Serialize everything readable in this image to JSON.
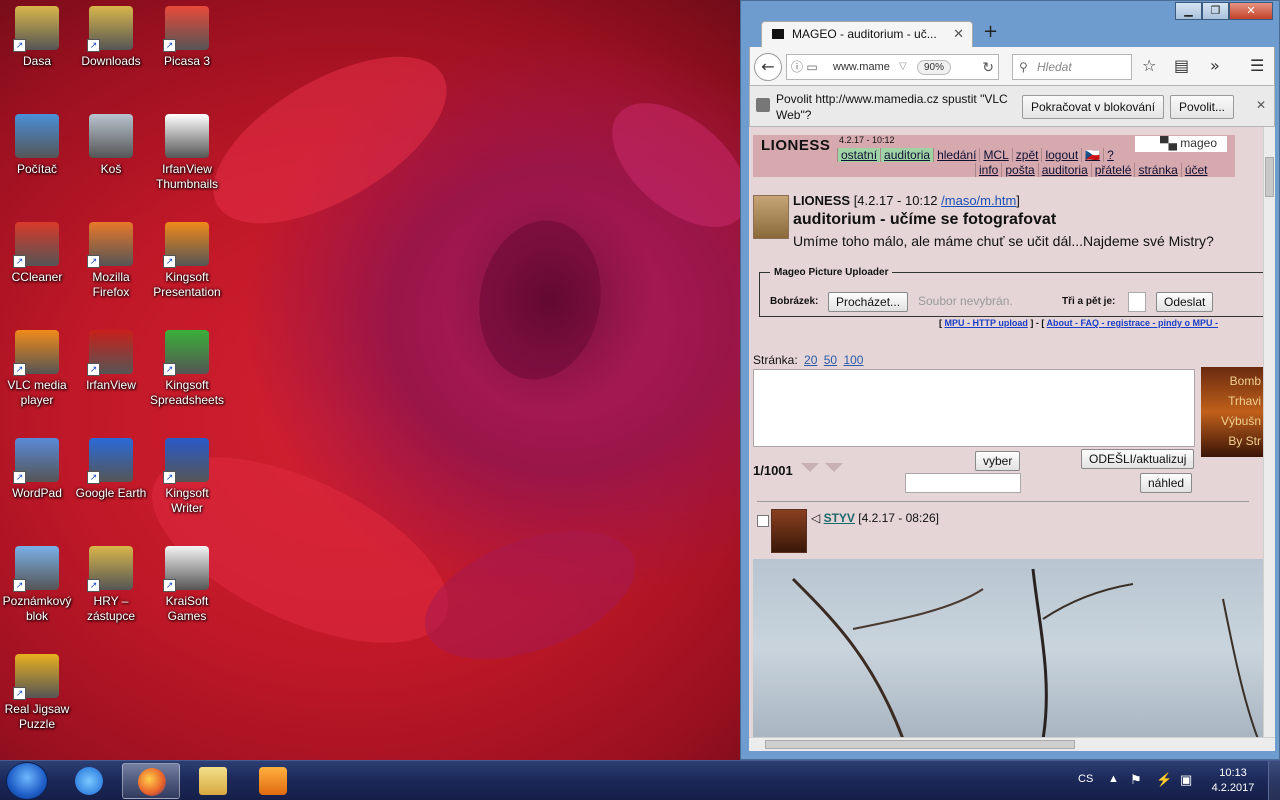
{
  "desktop": {
    "icons": [
      {
        "label": "Dasa",
        "icon": "user-folder-icon",
        "color": "#d8b64a"
      },
      {
        "label": "Downloads",
        "icon": "downloads-folder-icon",
        "color": "#d8b64a"
      },
      {
        "label": "Picasa 3",
        "icon": "picasa-icon",
        "color": "#e84a3a"
      },
      {
        "label": "Počítač",
        "icon": "computer-icon",
        "color": "#4a90d9"
      },
      {
        "label": "Koš",
        "icon": "recycle-bin-icon",
        "color": "#b8c4d0"
      },
      {
        "label": "IrfanView Thumbnails",
        "icon": "panda-icon",
        "color": "#ffffff"
      },
      {
        "label": "CCleaner",
        "icon": "ccleaner-icon",
        "color": "#d83a2a"
      },
      {
        "label": "Mozilla Firefox",
        "icon": "firefox-icon",
        "color": "#e8782a"
      },
      {
        "label": "Kingsoft Presentation",
        "icon": "kingsoft-presentation-icon",
        "color": "#f08a1a"
      },
      {
        "label": "VLC media player",
        "icon": "vlc-icon",
        "color": "#f08a1a"
      },
      {
        "label": "IrfanView",
        "icon": "irfanview-icon",
        "color": "#c8201a"
      },
      {
        "label": "Kingsoft Spreadsheets",
        "icon": "kingsoft-spreadsheets-icon",
        "color": "#3ab03a"
      },
      {
        "label": "WordPad",
        "icon": "wordpad-icon",
        "color": "#5a8ad8"
      },
      {
        "label": "Google Earth",
        "icon": "google-earth-icon",
        "color": "#2a6ad8"
      },
      {
        "label": "Kingsoft Writer",
        "icon": "kingsoft-writer-icon",
        "color": "#2a5ac8"
      },
      {
        "label": "Poznámkový blok",
        "icon": "notepad-icon",
        "color": "#7ab0e8"
      },
      {
        "label": "HRY – zástupce",
        "icon": "games-folder-icon",
        "color": "#d8b64a"
      },
      {
        "label": "KraiSoft Games",
        "icon": "file-icon",
        "color": "#f4f4f4"
      },
      {
        "label": "Real Jigsaw Puzzle",
        "icon": "jigsaw-icon",
        "color": "#e8b020"
      }
    ]
  },
  "browser": {
    "tab_title": "MAGEO - auditorium - uč...",
    "new_tab": "+",
    "url": "www.mame",
    "zoom": "90%",
    "search_placeholder": "Hledat",
    "notification": {
      "message": "Povolit http://www.mamedia.cz spustit \"VLC Web\"?",
      "continue_label": "Pokračovat v blokování",
      "allow_label": "Povolit..."
    }
  },
  "page": {
    "brand": "LIONESS",
    "header_date": "4.2.17 - 10:12",
    "logo": "▀▄ mageo",
    "menu_row1": [
      "ostatní",
      "auditoria",
      "hledání",
      "MCL",
      "zpět",
      "logout",
      "🇨🇿",
      "?"
    ],
    "menu_row2": [
      "info",
      "pošta",
      "auditoria",
      "přátelé",
      "stránka",
      "účet"
    ],
    "post": {
      "author": "LIONESS",
      "meta_open": " [4.2.17 - 10:12 ",
      "link": "/maso/m.htm",
      "meta_close": "]",
      "title": "auditorium - učíme se fotografovat",
      "description": "Umíme toho málo, ale máme chuť se učit dál...Najdeme své Mistry?"
    },
    "uploader": {
      "legend": "Mageo Picture Uploader",
      "image_label": "Bobrázek:",
      "browse_label": "Procházet...",
      "no_file": "Soubor nevybrán.",
      "captcha_label": "Tři a pět je:",
      "submit_label": "Odeslat"
    },
    "mpu_links": {
      "open1": "[ ",
      "link1": "MPU - HTTP upload",
      "mid": " ] - [ ",
      "link2": "About - FAQ - registrace - pindy o MPU -"
    },
    "pages_label": "Stránka:",
    "pages": [
      "20",
      "50",
      "100"
    ],
    "ad_lines": [
      "Bomb",
      "Trhavi",
      "Výbušn",
      "By Str"
    ],
    "counter": "1/1001",
    "select_label": "vyber",
    "send_label": "ODEŠLI/aktualizuj",
    "preview_label": "náhled",
    "comment": {
      "author": "STYV",
      "time": " [4.2.17 - 08:26]"
    }
  },
  "taskbar": {
    "language": "CS",
    "time": "10:13",
    "date": "4.2.2017"
  }
}
